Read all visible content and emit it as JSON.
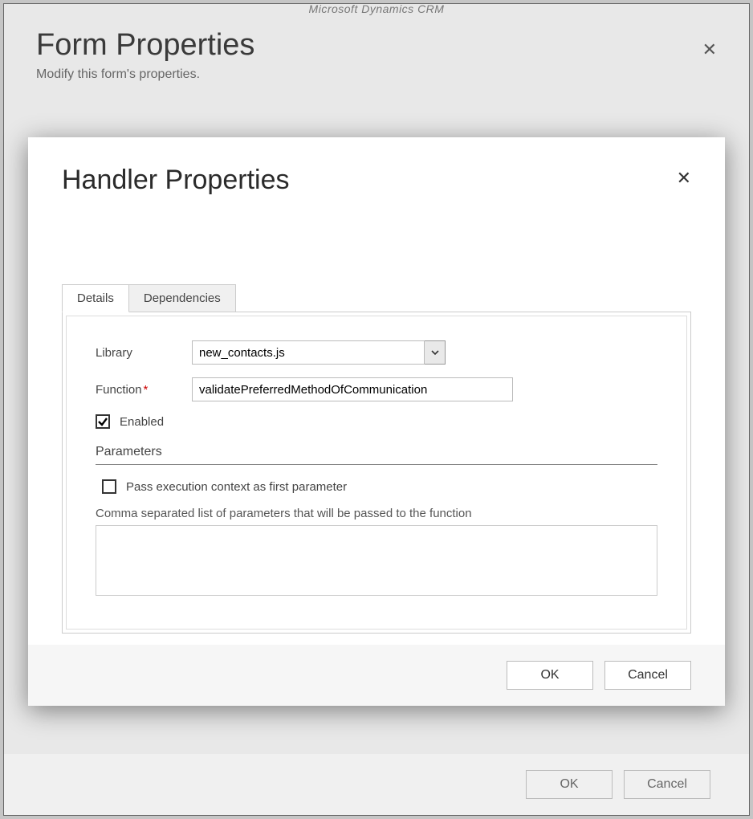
{
  "brand": "Microsoft Dynamics CRM",
  "form_properties": {
    "title": "Form Properties",
    "subtitle": "Modify this form's properties.",
    "close_glyph": "✕",
    "ok_label": "OK",
    "cancel_label": "Cancel"
  },
  "handler": {
    "title": "Handler Properties",
    "close_glyph": "✕",
    "tabs": {
      "details": "Details",
      "dependencies": "Dependencies"
    },
    "fields": {
      "library_label": "Library",
      "library_value": "new_contacts.js",
      "function_label": "Function",
      "function_required_mark": "*",
      "function_value": "validatePreferredMethodOfCommunication",
      "enabled_label": "Enabled",
      "enabled_checked": true
    },
    "parameters": {
      "section_title": "Parameters",
      "pass_context_label": "Pass execution context as first parameter",
      "pass_context_checked": false,
      "list_hint": "Comma separated list of parameters that will be passed to the function",
      "list_value": ""
    },
    "buttons": {
      "ok": "OK",
      "cancel": "Cancel"
    }
  }
}
